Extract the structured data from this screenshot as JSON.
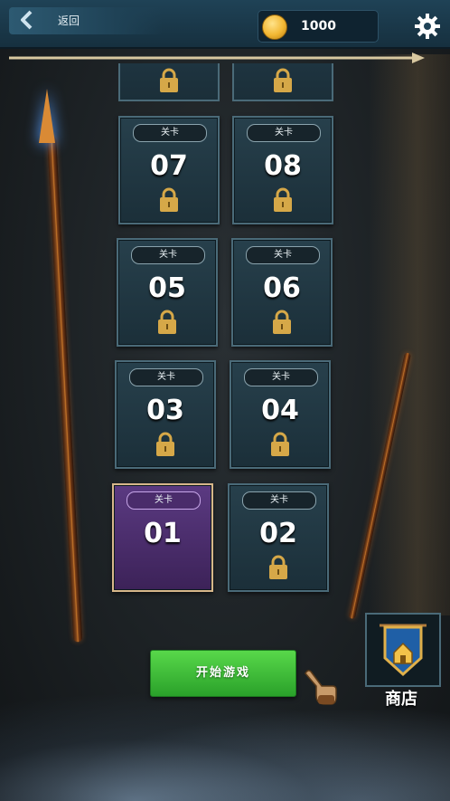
{
  "header": {
    "back_label": "返回",
    "coins": "1000"
  },
  "levels": [
    {
      "tag": "关卡",
      "number": "07",
      "locked": true
    },
    {
      "tag": "关卡",
      "number": "08",
      "locked": true
    },
    {
      "tag": "关卡",
      "number": "05",
      "locked": true
    },
    {
      "tag": "关卡",
      "number": "06",
      "locked": true
    },
    {
      "tag": "关卡",
      "number": "03",
      "locked": true
    },
    {
      "tag": "关卡",
      "number": "04",
      "locked": true
    },
    {
      "tag": "关卡",
      "number": "01",
      "locked": false,
      "selected": true
    },
    {
      "tag": "关卡",
      "number": "02",
      "locked": true
    }
  ],
  "start_button": "开始游戏",
  "shop_label": "商店",
  "colors": {
    "card_bg": "#1b2f39",
    "selected_bg": "#4a2c6b",
    "start_green": "#3dbd36",
    "coin_gold": "#f2b733"
  },
  "icons": [
    "back-arrow-icon",
    "coin-icon",
    "gear-icon",
    "lock-icon",
    "shop-castle-icon",
    "pointing-hand-icon"
  ]
}
